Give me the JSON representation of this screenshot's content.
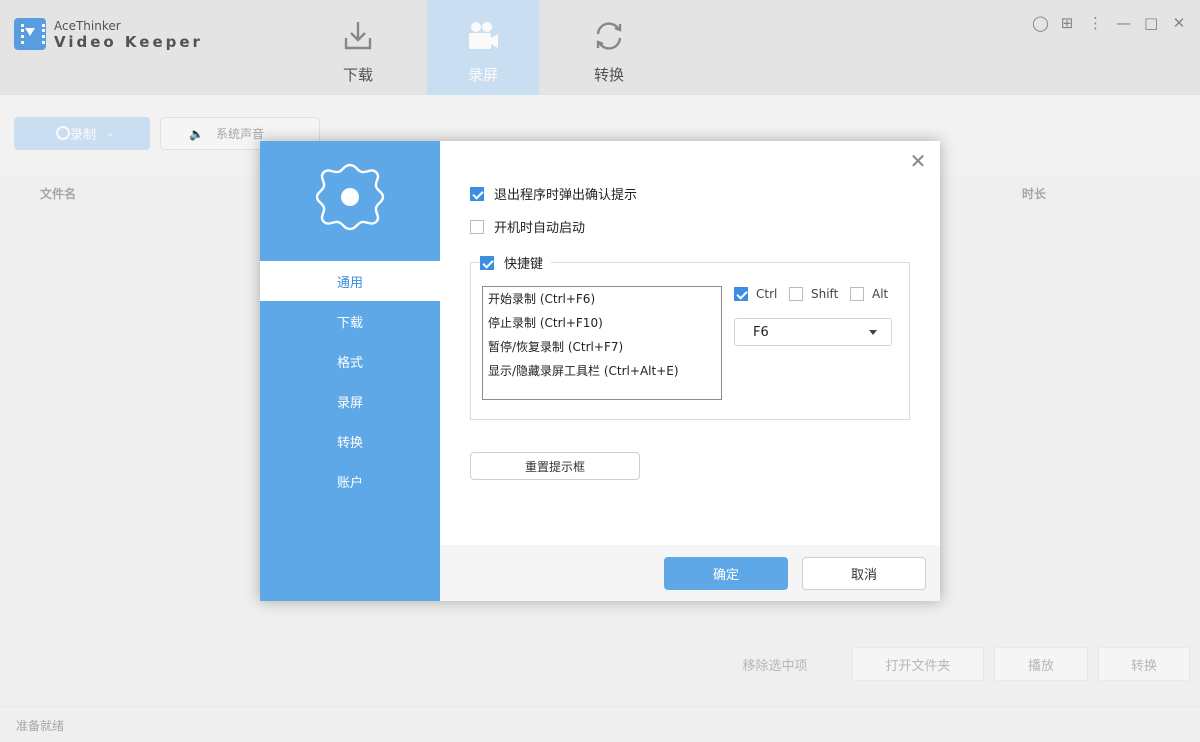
{
  "app": {
    "brand_small": "AceThinker",
    "brand_big": "Video Keeper"
  },
  "top_tabs": [
    {
      "label": "下载",
      "icon": "download-icon"
    },
    {
      "label": "录屏",
      "icon": "video-camera-icon"
    },
    {
      "label": "转换",
      "icon": "convert-icon"
    }
  ],
  "toolbar": {
    "record_label": "录制",
    "sound_label": "系统声音"
  },
  "columns": {
    "filename": "文件名",
    "duration": "时长"
  },
  "bottom_actions": {
    "remove_selected": "移除选中项",
    "open_folder": "打开文件夹",
    "play": "播放",
    "convert": "转换"
  },
  "status": "准备就绪",
  "settings": {
    "nav": [
      "通用",
      "下载",
      "格式",
      "录屏",
      "转换",
      "账户"
    ],
    "active_nav": "通用",
    "confirm_on_exit": {
      "label": "退出程序时弹出确认提示",
      "checked": true
    },
    "autostart": {
      "label": "开机时自动启动",
      "checked": false
    },
    "hotkeys": {
      "label": "快捷键",
      "enabled": true,
      "items": [
        "开始录制 (Ctrl+F6)",
        "停止录制 (Ctrl+F10)",
        "暂停/恢复录制 (Ctrl+F7)",
        "显示/隐藏录屏工具栏 (Ctrl+Alt+E)"
      ],
      "modifiers": {
        "ctrl": {
          "label": "Ctrl",
          "checked": true
        },
        "shift": {
          "label": "Shift",
          "checked": false
        },
        "alt": {
          "label": "Alt",
          "checked": false
        }
      },
      "key_value": "F6"
    },
    "reset_label": "重置提示框",
    "ok_label": "确定",
    "cancel_label": "取消"
  },
  "colors": {
    "accent": "#5fa8e8",
    "checkbox": "#3c8ee3"
  }
}
